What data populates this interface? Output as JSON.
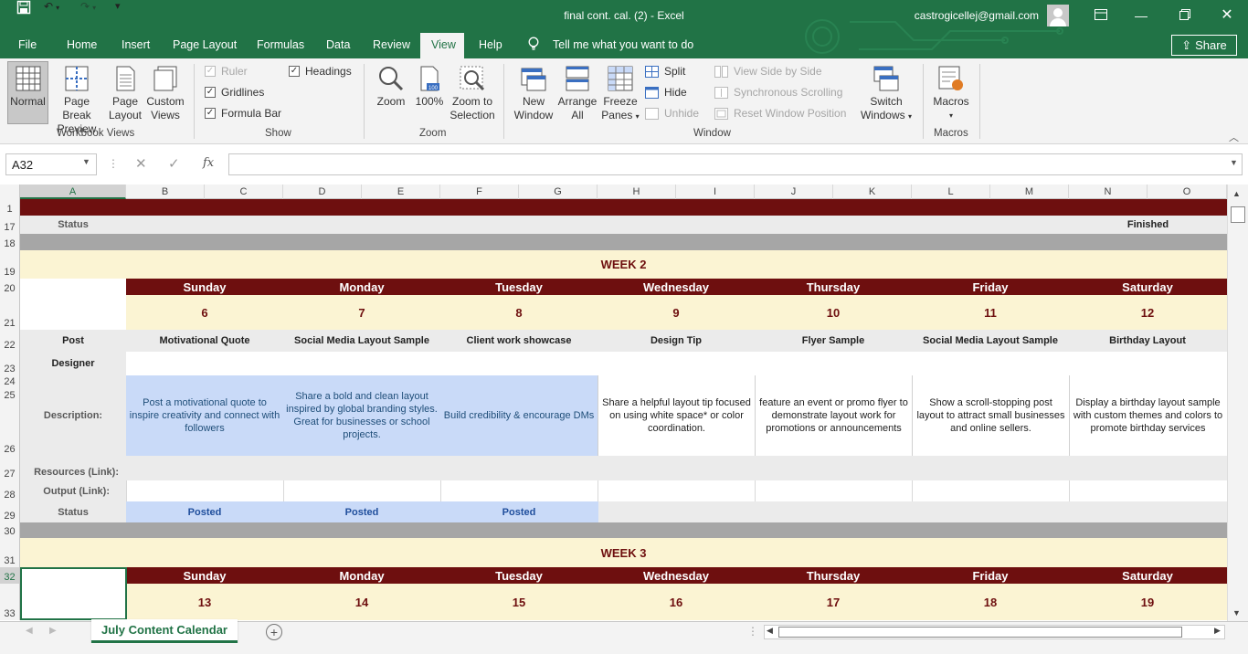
{
  "window": {
    "title": "final cont. cal. (2)  -  Excel",
    "account": "castrogicellej@gmail.com"
  },
  "menu_tabs": [
    "File",
    "Home",
    "Insert",
    "Page Layout",
    "Formulas",
    "Data",
    "Review",
    "View",
    "Help"
  ],
  "tell_me": "Tell me what you want to do",
  "share_label": "Share",
  "ribbon": {
    "workbook_views": {
      "label": "Workbook Views",
      "normal": "Normal",
      "page_break_1": "Page Break",
      "page_break_2": "Preview",
      "page_layout_1": "Page",
      "page_layout_2": "Layout",
      "custom_1": "Custom",
      "custom_2": "Views"
    },
    "show": {
      "label": "Show",
      "ruler": "Ruler",
      "gridlines": "Gridlines",
      "formula_bar": "Formula Bar",
      "headings": "Headings"
    },
    "zoom": {
      "label": "Zoom",
      "zoom": "Zoom",
      "hundred": "100%",
      "zoom_sel_1": "Zoom to",
      "zoom_sel_2": "Selection"
    },
    "window": {
      "label": "Window",
      "new_1": "New",
      "new_2": "Window",
      "arrange_1": "Arrange",
      "arrange_2": "All",
      "freeze_1": "Freeze",
      "freeze_2": "Panes",
      "split": "Split",
      "hide": "Hide",
      "unhide": "Unhide",
      "side_by_side": "View Side by Side",
      "sync_scroll": "Synchronous Scrolling",
      "reset_pos": "Reset Window Position",
      "switch_1": "Switch",
      "switch_2": "Windows"
    },
    "macros": {
      "label": "Macros",
      "macros": "Macros"
    }
  },
  "name_box": "A32",
  "fx": "fx",
  "columns": [
    "A",
    "B",
    "C",
    "D",
    "E",
    "F",
    "G",
    "H",
    "I",
    "J",
    "K",
    "L",
    "M",
    "N",
    "O"
  ],
  "rows": [
    "1",
    "17",
    "18",
    "19",
    "20",
    "21",
    "22",
    "23",
    "24",
    "25",
    "26",
    "27",
    "28",
    "29",
    "30",
    "31",
    "32",
    "33"
  ],
  "sheet": {
    "status_label": "Status",
    "finished": "Finished",
    "week2": {
      "title": "WEEK 2",
      "days": [
        "Sunday",
        "Monday",
        "Tuesday",
        "Wednesday",
        "Thursday",
        "Friday",
        "Saturday"
      ],
      "dates": [
        "6",
        "7",
        "8",
        "9",
        "10",
        "11",
        "12"
      ],
      "post_label": "Post",
      "posts": [
        "Motivational Quote",
        "Social Media Layout Sample",
        "Client work showcase",
        "Design Tip",
        "Flyer Sample",
        "Social Media Layout Sample",
        "Birthday Layout"
      ],
      "designer_label": "Designer",
      "description_label": "Description:",
      "descriptions": [
        "Post a motivational quote to inspire creativity and connect with followers",
        "Share a bold and clean layout inspired by global branding styles. Great for businesses or school projects.",
        "Build credibility & encourage DMs",
        "Share a helpful layout tip focused on using white space* or color coordination.",
        "feature an event or promo flyer to demonstrate layout work for promotions or announcements",
        "Show a scroll-stopping post layout to attract small businesses and online sellers.",
        "Display a birthday layout sample with custom themes and colors to promote birthday services"
      ],
      "resources_label": "Resources (Link):",
      "output_label": "Output (Link):",
      "status_label": "Status",
      "statuses": [
        "Posted",
        "Posted",
        "Posted"
      ]
    },
    "week3": {
      "title": "WEEK 3",
      "days": [
        "Sunday",
        "Monday",
        "Tuesday",
        "Wednesday",
        "Thursday",
        "Friday",
        "Saturday"
      ],
      "dates": [
        "13",
        "14",
        "15",
        "16",
        "17",
        "18",
        "19"
      ]
    }
  },
  "sheet_tab": "July Content Calendar",
  "colors": {
    "excel_green": "#217346",
    "maroon": "#6e0f0f",
    "cream": "#fbf4d3",
    "blue": "#c9daf8",
    "gray": "#a6a6a6"
  }
}
